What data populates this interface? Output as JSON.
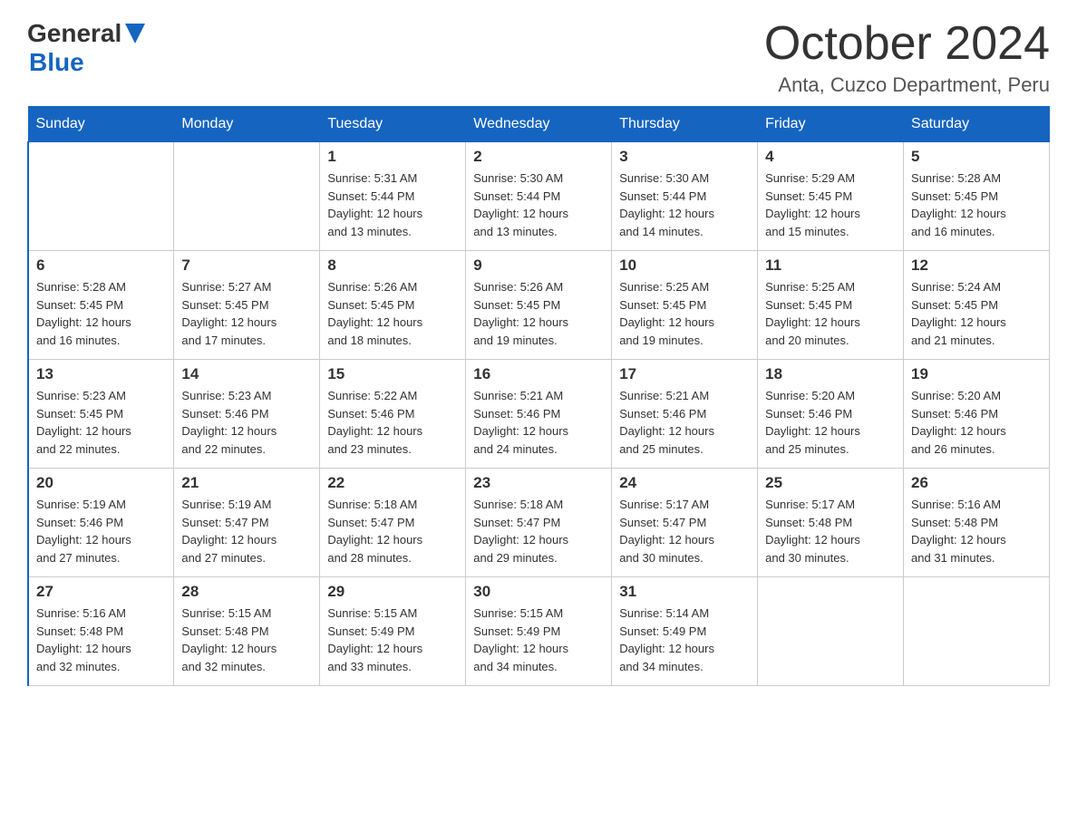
{
  "header": {
    "logo_general": "General",
    "logo_blue": "Blue",
    "month_title": "October 2024",
    "location": "Anta, Cuzco Department, Peru"
  },
  "days_of_week": [
    "Sunday",
    "Monday",
    "Tuesday",
    "Wednesday",
    "Thursday",
    "Friday",
    "Saturday"
  ],
  "weeks": [
    [
      {
        "day": "",
        "info": ""
      },
      {
        "day": "",
        "info": ""
      },
      {
        "day": "1",
        "info": "Sunrise: 5:31 AM\nSunset: 5:44 PM\nDaylight: 12 hours\nand 13 minutes."
      },
      {
        "day": "2",
        "info": "Sunrise: 5:30 AM\nSunset: 5:44 PM\nDaylight: 12 hours\nand 13 minutes."
      },
      {
        "day": "3",
        "info": "Sunrise: 5:30 AM\nSunset: 5:44 PM\nDaylight: 12 hours\nand 14 minutes."
      },
      {
        "day": "4",
        "info": "Sunrise: 5:29 AM\nSunset: 5:45 PM\nDaylight: 12 hours\nand 15 minutes."
      },
      {
        "day": "5",
        "info": "Sunrise: 5:28 AM\nSunset: 5:45 PM\nDaylight: 12 hours\nand 16 minutes."
      }
    ],
    [
      {
        "day": "6",
        "info": "Sunrise: 5:28 AM\nSunset: 5:45 PM\nDaylight: 12 hours\nand 16 minutes."
      },
      {
        "day": "7",
        "info": "Sunrise: 5:27 AM\nSunset: 5:45 PM\nDaylight: 12 hours\nand 17 minutes."
      },
      {
        "day": "8",
        "info": "Sunrise: 5:26 AM\nSunset: 5:45 PM\nDaylight: 12 hours\nand 18 minutes."
      },
      {
        "day": "9",
        "info": "Sunrise: 5:26 AM\nSunset: 5:45 PM\nDaylight: 12 hours\nand 19 minutes."
      },
      {
        "day": "10",
        "info": "Sunrise: 5:25 AM\nSunset: 5:45 PM\nDaylight: 12 hours\nand 19 minutes."
      },
      {
        "day": "11",
        "info": "Sunrise: 5:25 AM\nSunset: 5:45 PM\nDaylight: 12 hours\nand 20 minutes."
      },
      {
        "day": "12",
        "info": "Sunrise: 5:24 AM\nSunset: 5:45 PM\nDaylight: 12 hours\nand 21 minutes."
      }
    ],
    [
      {
        "day": "13",
        "info": "Sunrise: 5:23 AM\nSunset: 5:45 PM\nDaylight: 12 hours\nand 22 minutes."
      },
      {
        "day": "14",
        "info": "Sunrise: 5:23 AM\nSunset: 5:46 PM\nDaylight: 12 hours\nand 22 minutes."
      },
      {
        "day": "15",
        "info": "Sunrise: 5:22 AM\nSunset: 5:46 PM\nDaylight: 12 hours\nand 23 minutes."
      },
      {
        "day": "16",
        "info": "Sunrise: 5:21 AM\nSunset: 5:46 PM\nDaylight: 12 hours\nand 24 minutes."
      },
      {
        "day": "17",
        "info": "Sunrise: 5:21 AM\nSunset: 5:46 PM\nDaylight: 12 hours\nand 25 minutes."
      },
      {
        "day": "18",
        "info": "Sunrise: 5:20 AM\nSunset: 5:46 PM\nDaylight: 12 hours\nand 25 minutes."
      },
      {
        "day": "19",
        "info": "Sunrise: 5:20 AM\nSunset: 5:46 PM\nDaylight: 12 hours\nand 26 minutes."
      }
    ],
    [
      {
        "day": "20",
        "info": "Sunrise: 5:19 AM\nSunset: 5:46 PM\nDaylight: 12 hours\nand 27 minutes."
      },
      {
        "day": "21",
        "info": "Sunrise: 5:19 AM\nSunset: 5:47 PM\nDaylight: 12 hours\nand 27 minutes."
      },
      {
        "day": "22",
        "info": "Sunrise: 5:18 AM\nSunset: 5:47 PM\nDaylight: 12 hours\nand 28 minutes."
      },
      {
        "day": "23",
        "info": "Sunrise: 5:18 AM\nSunset: 5:47 PM\nDaylight: 12 hours\nand 29 minutes."
      },
      {
        "day": "24",
        "info": "Sunrise: 5:17 AM\nSunset: 5:47 PM\nDaylight: 12 hours\nand 30 minutes."
      },
      {
        "day": "25",
        "info": "Sunrise: 5:17 AM\nSunset: 5:48 PM\nDaylight: 12 hours\nand 30 minutes."
      },
      {
        "day": "26",
        "info": "Sunrise: 5:16 AM\nSunset: 5:48 PM\nDaylight: 12 hours\nand 31 minutes."
      }
    ],
    [
      {
        "day": "27",
        "info": "Sunrise: 5:16 AM\nSunset: 5:48 PM\nDaylight: 12 hours\nand 32 minutes."
      },
      {
        "day": "28",
        "info": "Sunrise: 5:15 AM\nSunset: 5:48 PM\nDaylight: 12 hours\nand 32 minutes."
      },
      {
        "day": "29",
        "info": "Sunrise: 5:15 AM\nSunset: 5:49 PM\nDaylight: 12 hours\nand 33 minutes."
      },
      {
        "day": "30",
        "info": "Sunrise: 5:15 AM\nSunset: 5:49 PM\nDaylight: 12 hours\nand 34 minutes."
      },
      {
        "day": "31",
        "info": "Sunrise: 5:14 AM\nSunset: 5:49 PM\nDaylight: 12 hours\nand 34 minutes."
      },
      {
        "day": "",
        "info": ""
      },
      {
        "day": "",
        "info": ""
      }
    ]
  ]
}
